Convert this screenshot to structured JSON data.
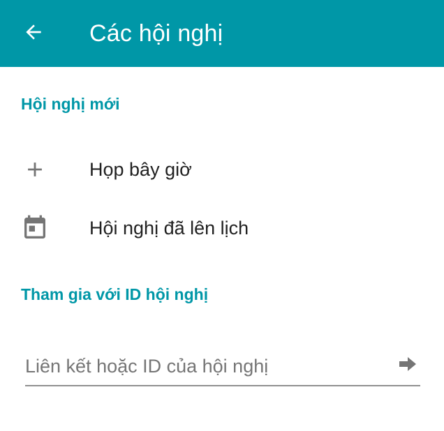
{
  "app_bar": {
    "back_icon": "arrow-back-icon",
    "title": "Các hội nghị",
    "background_color": "#0097a7"
  },
  "new_conference": {
    "header": "Hội nghị mới",
    "items": [
      {
        "icon": "plus-icon",
        "label": "Họp bây giờ"
      },
      {
        "icon": "calendar-icon",
        "label": "Hội nghị đã lên lịch"
      }
    ]
  },
  "join": {
    "header": "Tham gia với ID hội nghị",
    "input_value": "",
    "input_placeholder": "Liên kết hoặc ID của hội nghị",
    "submit_icon": "arrow-forward-icon"
  },
  "colors": {
    "accent": "#0097a7",
    "icon_gray": "#757575",
    "text": "#212121"
  }
}
